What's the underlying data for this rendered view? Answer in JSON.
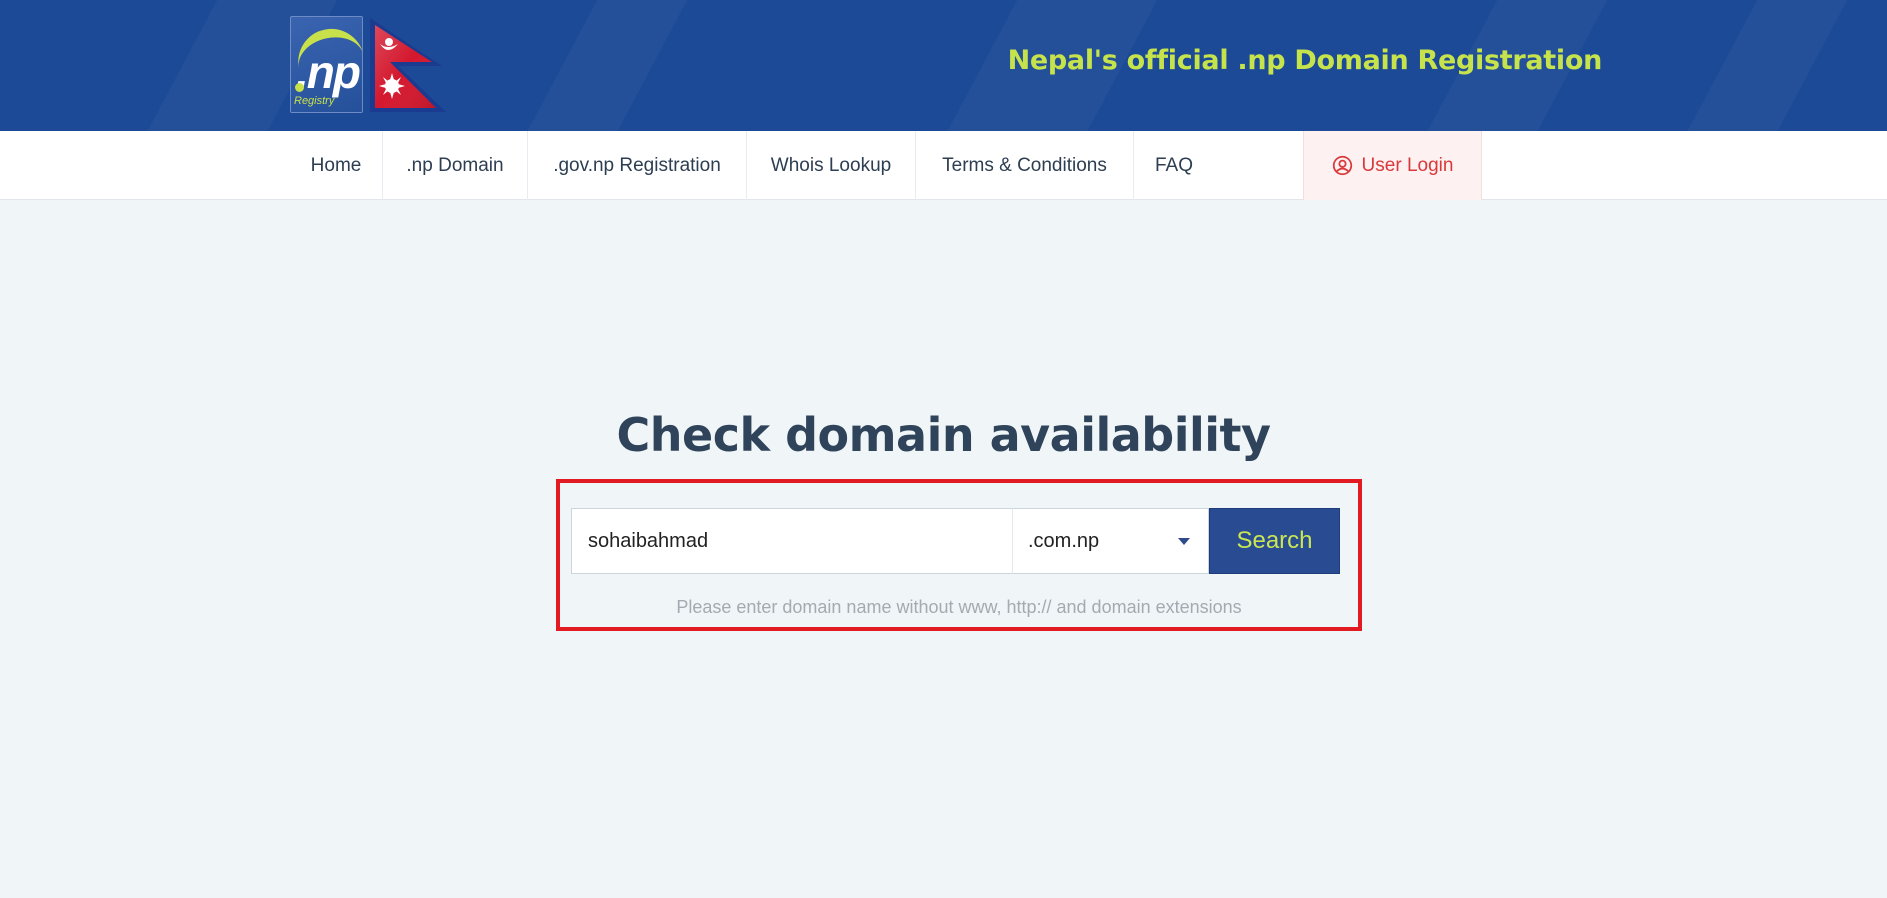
{
  "colors": {
    "banner_bg": "#1c4a96",
    "accent_green": "#c6e34b",
    "nav_text": "#2d3e52",
    "login_red": "#d9393b",
    "button_bg": "#294b92",
    "highlight_red": "#e21b23",
    "page_bg": "#f0f5f7"
  },
  "header": {
    "logo": {
      "mark": ".np",
      "sub": "Registry",
      "flag_icon": "nepal-flag-icon"
    },
    "title": "Nepal's official .np Domain Registration"
  },
  "nav": {
    "items": [
      {
        "label": "Home"
      },
      {
        "label": ".np Domain"
      },
      {
        "label": ".gov.np Registration"
      },
      {
        "label": "Whois Lookup"
      },
      {
        "label": "Terms & Conditions"
      },
      {
        "label": "FAQ"
      }
    ],
    "login": {
      "label": "User Login",
      "icon": "user-circle-icon"
    }
  },
  "main": {
    "heading": "Check domain availability",
    "search": {
      "domain_value": "sohaibahmad",
      "extension_selected": ".com.np",
      "button_label": "Search",
      "hint": "Please enter domain name without www, http:// and domain extensions"
    }
  }
}
